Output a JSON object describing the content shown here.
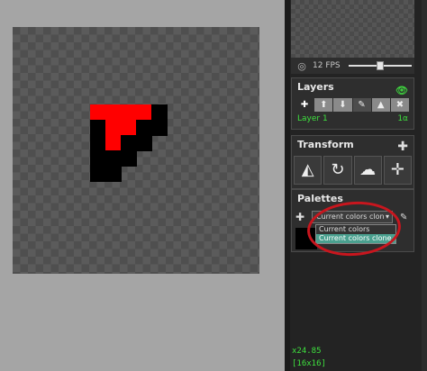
{
  "colors": {
    "primary": "#ff0000",
    "secondary": "#000000",
    "accent_green": "#3ee13e",
    "highlight_red": "#c8161e",
    "selected_option": "#4aa08f"
  },
  "canvas": {
    "grid_size": 16,
    "pixels": [
      {
        "c": 5,
        "r": 5,
        "color": "red"
      },
      {
        "c": 6,
        "r": 5,
        "color": "red"
      },
      {
        "c": 7,
        "r": 5,
        "color": "red"
      },
      {
        "c": 8,
        "r": 5,
        "color": "red"
      },
      {
        "c": 9,
        "r": 5,
        "color": "black"
      },
      {
        "c": 5,
        "r": 6,
        "color": "black"
      },
      {
        "c": 6,
        "r": 6,
        "color": "red"
      },
      {
        "c": 7,
        "r": 6,
        "color": "red"
      },
      {
        "c": 8,
        "r": 6,
        "color": "black"
      },
      {
        "c": 9,
        "r": 6,
        "color": "black"
      },
      {
        "c": 5,
        "r": 7,
        "color": "black"
      },
      {
        "c": 6,
        "r": 7,
        "color": "red"
      },
      {
        "c": 7,
        "r": 7,
        "color": "black"
      },
      {
        "c": 8,
        "r": 7,
        "color": "black"
      },
      {
        "c": 5,
        "r": 8,
        "color": "black"
      },
      {
        "c": 6,
        "r": 8,
        "color": "black"
      },
      {
        "c": 7,
        "r": 8,
        "color": "black"
      },
      {
        "c": 5,
        "r": 9,
        "color": "black"
      },
      {
        "c": 6,
        "r": 9,
        "color": "black"
      }
    ]
  },
  "preview": {
    "fps_label": "12 FPS",
    "fps_value": 12
  },
  "layers": {
    "title": "Layers",
    "items": [
      {
        "name": "Layer 1",
        "opacity": "1α"
      }
    ]
  },
  "transform": {
    "title": "Transform"
  },
  "palettes": {
    "title": "Palettes",
    "selected": "Current colors clon",
    "options": [
      "Current colors",
      "Current colors clone"
    ]
  },
  "status": {
    "zoom": "x24.85",
    "size": "[16x16]"
  }
}
